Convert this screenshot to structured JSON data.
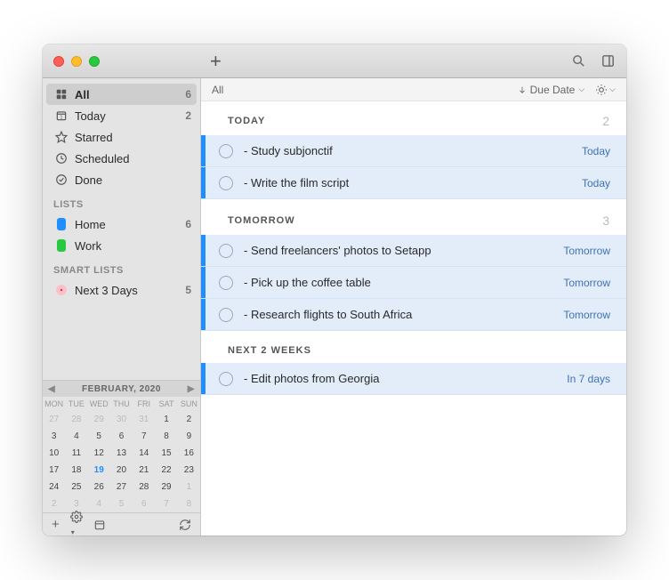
{
  "sidebar": {
    "smart": [
      {
        "icon": "grid",
        "label": "All",
        "count": "6",
        "selected": true
      },
      {
        "icon": "calendar",
        "label": "Today",
        "count": "2"
      },
      {
        "icon": "star",
        "label": "Starred",
        "count": ""
      },
      {
        "icon": "clock",
        "label": "Scheduled",
        "count": ""
      },
      {
        "icon": "check",
        "label": "Done",
        "count": ""
      }
    ],
    "lists_header": "LISTS",
    "lists": [
      {
        "color": "blue",
        "label": "Home",
        "count": "6"
      },
      {
        "color": "green2",
        "label": "Work",
        "count": ""
      }
    ],
    "smartlists_header": "SMART LISTS",
    "smartlists": [
      {
        "color": "pink",
        "label": "Next 3 Days",
        "count": "5"
      }
    ]
  },
  "calendar": {
    "title": "FEBRUARY, 2020",
    "dow": [
      "MON",
      "TUE",
      "WED",
      "THU",
      "FRI",
      "SAT",
      "SUN"
    ],
    "days": [
      {
        "n": "27",
        "o": true
      },
      {
        "n": "28",
        "o": true
      },
      {
        "n": "29",
        "o": true
      },
      {
        "n": "30",
        "o": true
      },
      {
        "n": "31",
        "o": true
      },
      {
        "n": "1"
      },
      {
        "n": "2"
      },
      {
        "n": "3"
      },
      {
        "n": "4"
      },
      {
        "n": "5"
      },
      {
        "n": "6"
      },
      {
        "n": "7"
      },
      {
        "n": "8"
      },
      {
        "n": "9"
      },
      {
        "n": "10"
      },
      {
        "n": "11"
      },
      {
        "n": "12"
      },
      {
        "n": "13"
      },
      {
        "n": "14"
      },
      {
        "n": "15"
      },
      {
        "n": "16"
      },
      {
        "n": "17"
      },
      {
        "n": "18"
      },
      {
        "n": "19",
        "t": true
      },
      {
        "n": "20"
      },
      {
        "n": "21"
      },
      {
        "n": "22"
      },
      {
        "n": "23"
      },
      {
        "n": "24"
      },
      {
        "n": "25"
      },
      {
        "n": "26"
      },
      {
        "n": "27"
      },
      {
        "n": "28"
      },
      {
        "n": "29"
      },
      {
        "n": "1",
        "o": true
      },
      {
        "n": "2",
        "o": true
      },
      {
        "n": "3",
        "o": true
      },
      {
        "n": "4",
        "o": true
      },
      {
        "n": "5",
        "o": true
      },
      {
        "n": "6",
        "o": true
      },
      {
        "n": "7",
        "o": true
      },
      {
        "n": "8",
        "o": true
      }
    ]
  },
  "main": {
    "breadcrumb": "All",
    "sort_label": "Due Date",
    "sections": [
      {
        "title": "TODAY",
        "count": "2",
        "tasks": [
          {
            "title": "- Study subjonctif",
            "due": "Today"
          },
          {
            "title": "- Write the film script",
            "due": "Today"
          }
        ]
      },
      {
        "title": "TOMORROW",
        "count": "3",
        "tasks": [
          {
            "title": "- Send freelancers' photos to Setapp",
            "due": "Tomorrow"
          },
          {
            "title": "- Pick up the coffee table",
            "due": "Tomorrow"
          },
          {
            "title": "- Research flights to South Africa",
            "due": "Tomorrow"
          }
        ]
      },
      {
        "title": "NEXT 2 WEEKS",
        "count": "",
        "tasks": [
          {
            "title": "- Edit photos from Georgia",
            "due": "In 7 days"
          }
        ]
      }
    ]
  }
}
